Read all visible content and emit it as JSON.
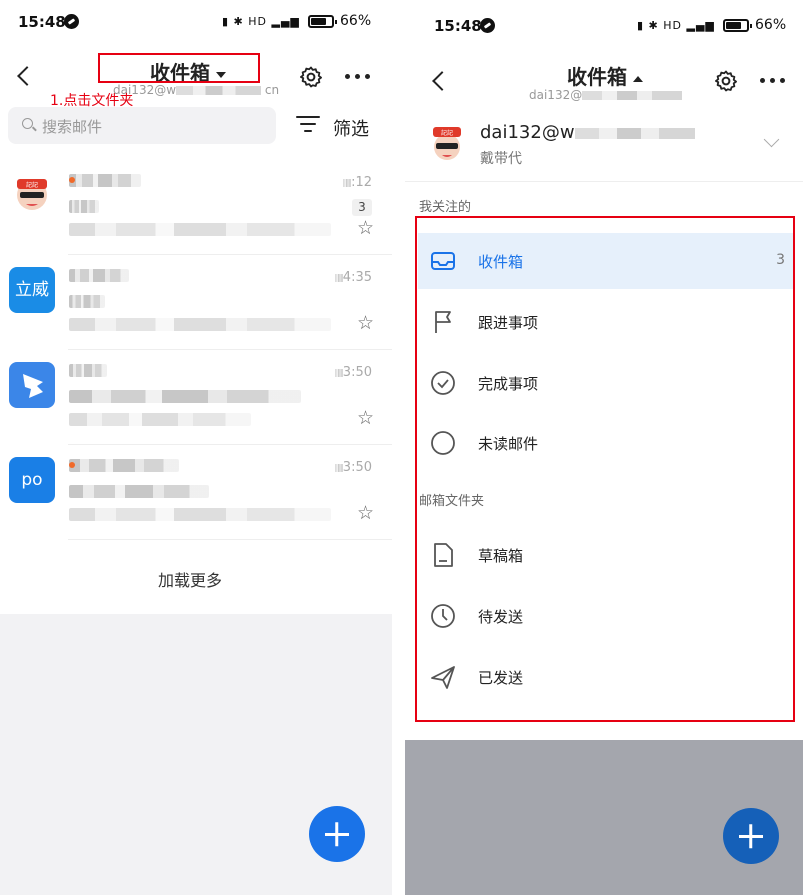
{
  "status_bar": {
    "time": "15:48",
    "battery": "66%",
    "indicators": "HD"
  },
  "left": {
    "header": {
      "title": "收件箱",
      "account_prefix": "dai132@w",
      "account_suffix": "cn"
    },
    "annotation": "1.点击文件夹",
    "search": {
      "placeholder": "搜索邮件"
    },
    "filter_label": "筛选",
    "mails": [
      {
        "avatar_text": "",
        "avatar_color": "#ffffff",
        "time_suffix": ":12",
        "count": "3"
      },
      {
        "avatar_text": "立威",
        "avatar_color": "#1a8ce6",
        "time_suffix": "4:35",
        "count": ""
      },
      {
        "avatar_text": "",
        "avatar_color": "#3b86e8",
        "time_suffix": "3:50",
        "count": ""
      },
      {
        "avatar_text": "po",
        "avatar_color": "#1a7fe6",
        "time_suffix": "3:50",
        "count": ""
      }
    ],
    "load_more": "加载更多"
  },
  "right": {
    "header": {
      "title": "收件箱",
      "account_prefix": "dai132@"
    },
    "account": {
      "email_prefix": "dai132@w",
      "name": "戴带代"
    },
    "sections": {
      "followed": {
        "title": "我关注的",
        "items": [
          {
            "label": "收件箱",
            "count": "3",
            "icon": "inbox-icon"
          },
          {
            "label": "跟进事项",
            "count": "",
            "icon": "flag-icon"
          },
          {
            "label": "完成事项",
            "count": "",
            "icon": "check-circle-icon"
          },
          {
            "label": "未读邮件",
            "count": "",
            "icon": "circle-icon"
          }
        ]
      },
      "folders": {
        "title": "邮箱文件夹",
        "items": [
          {
            "label": "草稿箱",
            "icon": "draft-icon"
          },
          {
            "label": "待发送",
            "icon": "clock-icon"
          },
          {
            "label": "已发送",
            "icon": "send-icon"
          }
        ]
      }
    }
  },
  "colors": {
    "accent": "#1a73e8",
    "annotation_red": "#e60012",
    "active_bg": "#e6f0fb"
  }
}
